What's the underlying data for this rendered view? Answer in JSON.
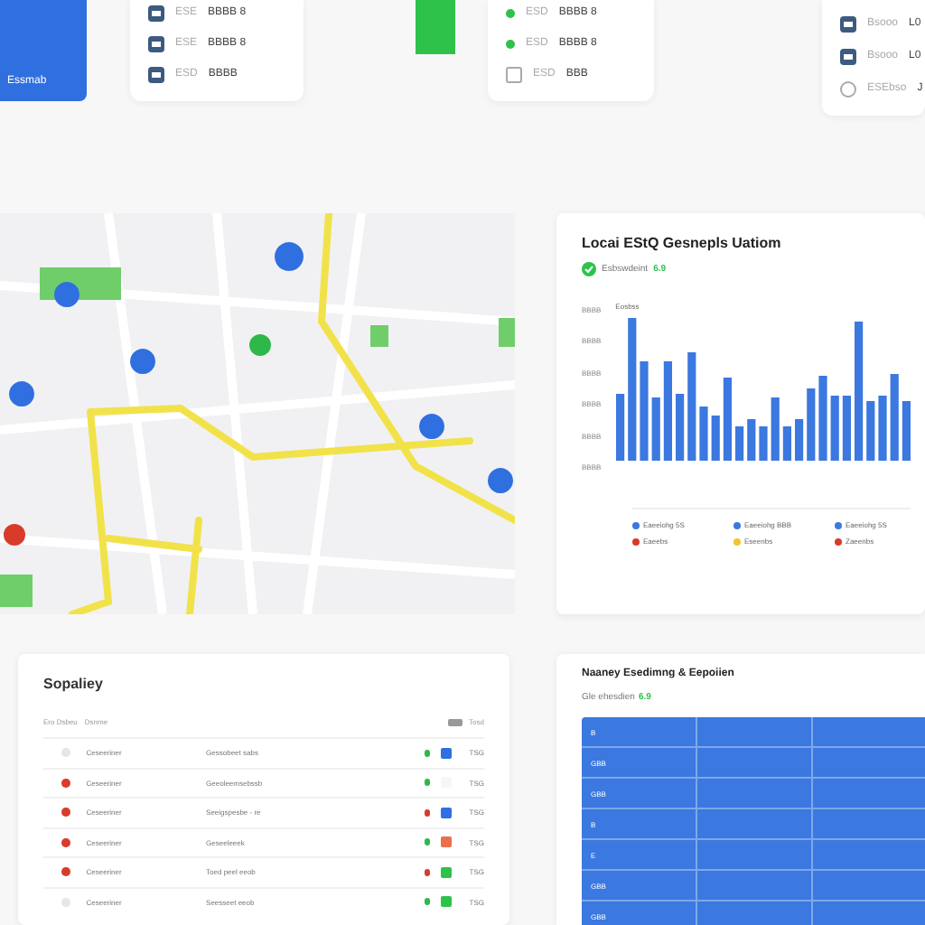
{
  "top_cards": [
    {
      "kind": "blue",
      "label": "Essmab"
    },
    {
      "kind": "list",
      "rows": [
        {
          "kind": "app",
          "code": "ESE",
          "value": "BBBB 8"
        },
        {
          "kind": "app",
          "code": "ESE",
          "value": "BBBB 8"
        },
        {
          "kind": "app",
          "code": "ESD",
          "value": "BBBB"
        }
      ]
    },
    {
      "kind": "tab"
    },
    {
      "kind": "list",
      "rows": [
        {
          "kind": "dot",
          "code": "ESD",
          "value": "BBBB 8"
        },
        {
          "kind": "dot",
          "code": "ESD",
          "value": "BBBB 8"
        },
        {
          "kind": "box",
          "code": "ESD",
          "value": "BBB"
        }
      ]
    },
    {
      "kind": "list",
      "rows": [
        {
          "kind": "app",
          "code": "Bsooo",
          "value": "L0"
        },
        {
          "kind": "app",
          "code": "Bsooo",
          "value": "L0"
        },
        {
          "kind": "circle",
          "code": "ESEbso",
          "value": "J"
        }
      ]
    }
  ],
  "chart_card": {
    "title": "Locai EStQ Gesnepls Uatiom",
    "subtitle": "Esbswdeint",
    "delta": "6.9",
    "series_label": "Eosbss",
    "y_labels": [
      "BBBB",
      "BBBB",
      "BBBB",
      "BBBB",
      "BBBB",
      "BBBB"
    ],
    "legend": [
      {
        "label": "Eaeeiohg 5S",
        "color": "#3b78e0"
      },
      {
        "label": "Eaeeiohg BBB",
        "color": "#3b78e0"
      },
      {
        "label": "Eaeeiohg 5S",
        "color": "#3b78e0"
      },
      {
        "label": "Eaeebs",
        "color": "#d93b2b"
      },
      {
        "label": "Eseenbs",
        "color": "#f2c230"
      },
      {
        "label": "Zaeenbs",
        "color": "#d93b2b"
      }
    ]
  },
  "activity": {
    "title": "Sopaliey",
    "filters": [
      "Ero Dsbeu",
      "Dsnme"
    ],
    "sort": "Tosd",
    "rows": [
      {
        "alert": false,
        "name": "Ceseeriner",
        "detail": "Gessobeet sabs",
        "rising": true,
        "color": "#2f6fe0",
        "value": "TSG"
      },
      {
        "alert": true,
        "name": "Ceseeriner",
        "detail": "Geeoleemsebssb",
        "rising": true,
        "color": "#f4f6f8",
        "value": "TSG"
      },
      {
        "alert": true,
        "name": "Ceseeriner",
        "detail": "Seeigspesbe - re",
        "rising": false,
        "color": "#2f6fe0",
        "value": "TSG"
      },
      {
        "alert": true,
        "name": "Ceseeriner",
        "detail": "Geseeleeek",
        "rising": true,
        "color": "#e8704a",
        "value": "TSG"
      },
      {
        "alert": true,
        "name": "Ceseeriner",
        "detail": "Toed peel eeob",
        "rising": false,
        "color": "#2fc24a",
        "value": "TSG"
      },
      {
        "alert": false,
        "name": "Ceseeriner",
        "detail": "Seesseet eeob",
        "rising": true,
        "color": "#2fc24a",
        "value": "TSG"
      }
    ]
  },
  "grid_card": {
    "title": "Naaney Esedimng & Eepoiien",
    "subtitle": "Gle ehesdien",
    "delta": "6.9",
    "rows": [
      [
        "B",
        "",
        ""
      ],
      [
        "GBB",
        "",
        ""
      ],
      [
        "GBB",
        "",
        ""
      ],
      [
        "B",
        "",
        ""
      ],
      [
        "E",
        "",
        ""
      ],
      [
        "GBB",
        "",
        ""
      ],
      [
        "GBB",
        "",
        ""
      ]
    ]
  }
}
